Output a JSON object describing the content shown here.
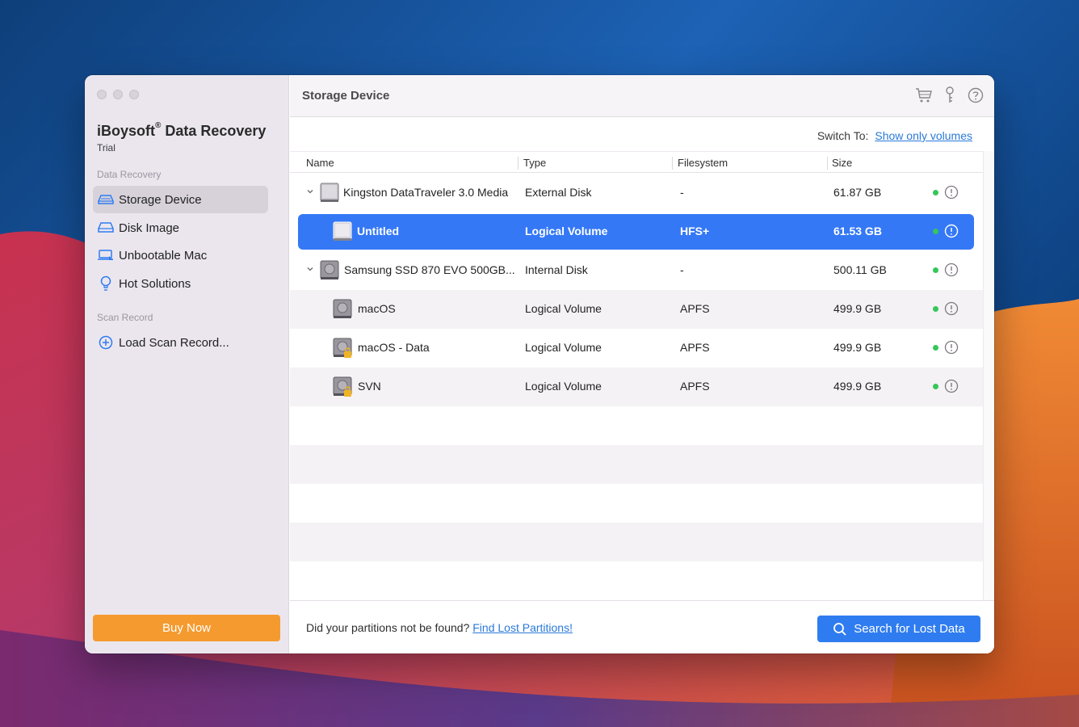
{
  "app": {
    "name": "iBoysoft",
    "registered": "®",
    "name_suffix": " Data Recovery",
    "edition": "Trial"
  },
  "sidebar": {
    "section_recovery": "Data Recovery",
    "items": [
      {
        "label": "Storage Device",
        "icon": "hard-drive-icon",
        "active": true
      },
      {
        "label": "Disk Image",
        "icon": "disk-image-icon",
        "active": false
      },
      {
        "label": "Unbootable Mac",
        "icon": "laptop-icon",
        "active": false
      },
      {
        "label": "Hot Solutions",
        "icon": "lightbulb-icon",
        "active": false
      }
    ],
    "section_scan": "Scan Record",
    "load_scan": "Load Scan Record...",
    "buy_label": "Buy Now"
  },
  "header": {
    "title": "Storage Device",
    "icons": [
      "cart-icon",
      "key-icon",
      "help-icon"
    ]
  },
  "switch": {
    "label": "Switch To:",
    "link": "Show only volumes"
  },
  "table": {
    "columns": [
      "Name",
      "Type",
      "Filesystem",
      "Size"
    ],
    "rows": [
      {
        "name": "Kingston DataTraveler 3.0 Media",
        "type": "External Disk",
        "filesystem": "-",
        "size": "61.87 GB",
        "level": 0,
        "icon": "external-disk-icon"
      },
      {
        "name": "Untitled",
        "type": "Logical Volume",
        "filesystem": "HFS+",
        "size": "61.53 GB",
        "level": 1,
        "icon": "volume-icon",
        "selected": true
      },
      {
        "name": "Samsung SSD 870 EVO 500GB...",
        "type": "Internal Disk",
        "filesystem": "-",
        "size": "500.11 GB",
        "level": 0,
        "icon": "internal-disk-icon"
      },
      {
        "name": "macOS",
        "type": "Logical Volume",
        "filesystem": "APFS",
        "size": "499.9 GB",
        "level": 1,
        "icon": "volume-icon"
      },
      {
        "name": "macOS - Data",
        "type": "Logical Volume",
        "filesystem": "APFS",
        "size": "499.9 GB",
        "level": 1,
        "icon": "locked-volume-icon"
      },
      {
        "name": "SVN",
        "type": "Logical Volume",
        "filesystem": "APFS",
        "size": "499.9 GB",
        "level": 1,
        "icon": "locked-volume-icon"
      }
    ]
  },
  "footer": {
    "question": "Did your partitions not be found?",
    "link": "Find Lost Partitions!",
    "search_label": "Search for Lost Data"
  },
  "colors": {
    "accent": "#3478f6",
    "buy": "#f59a2f",
    "status_ok": "#34c759",
    "link": "#2a79d9"
  }
}
